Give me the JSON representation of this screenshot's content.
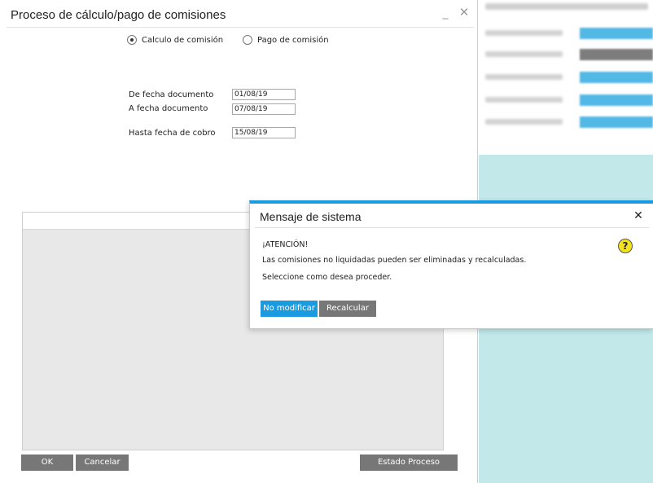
{
  "main_window": {
    "title": "Proceso de cálculo/pago de comisiones",
    "radio_calculo": "Calculo de comisión",
    "radio_pago": "Pago de comisión",
    "selected_option": "calculo",
    "label_de_fecha": "De fecha documento",
    "label_a_fecha": "A fecha documento",
    "label_hasta_fecha": "Hasta fecha de cobro",
    "value_de_fecha": "01/08/19",
    "value_a_fecha": "07/08/19",
    "value_hasta_fecha": "15/08/19",
    "ok_label": "OK",
    "cancel_label": "Cancelar",
    "estado_label": "Estado Proceso"
  },
  "dialog": {
    "title": "Mensaje de sistema",
    "line1": "¡ATENCIÓN!",
    "line2": "Las comisiones no liquidadas pueden ser eliminadas y recalculadas.",
    "line3": "Seleccione como desea proceder.",
    "no_modificar_label": "No modificar",
    "recalcular_label": "Recalcular"
  },
  "colors": {
    "accent": "#1a9be0",
    "button_grey": "#777777",
    "background_teal": "#c2e8ea",
    "question_yellow": "#f3e21d"
  }
}
